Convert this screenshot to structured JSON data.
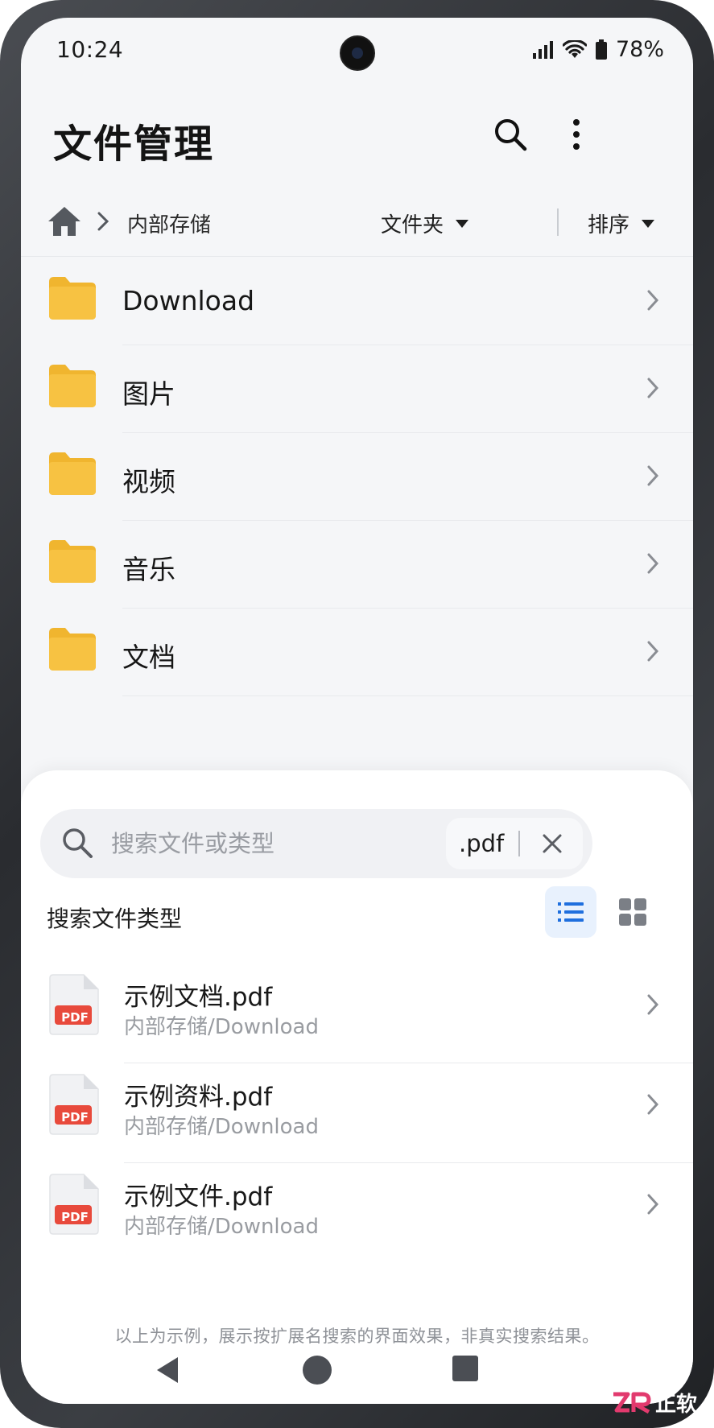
{
  "status_bar": {
    "time": "10:24",
    "battery": "78%"
  },
  "header": {
    "title": "文件管理",
    "search_icon": "search-icon",
    "more_icon": "more-vert-icon"
  },
  "breadcrumb": {
    "home_icon": "home-icon",
    "current": "内部存储",
    "filter_label": "文件夹",
    "sort_label": "排序"
  },
  "folders": [
    {
      "name": "Download"
    },
    {
      "name": "图片"
    },
    {
      "name": "视频"
    },
    {
      "name": "音乐"
    },
    {
      "name": "文档"
    }
  ],
  "search": {
    "placeholder": "搜索文件或类型",
    "value": "",
    "extension_chip": ".pdf"
  },
  "results_section": {
    "title": "搜索文件类型",
    "items": [
      {
        "name": "示例文档.pdf",
        "path": "内部存储/Download",
        "badge": "PDF"
      },
      {
        "name": "示例资料.pdf",
        "path": "内部存储/Download",
        "badge": "PDF"
      },
      {
        "name": "示例文件.pdf",
        "path": "内部存储/Download",
        "badge": "PDF"
      }
    ],
    "footnote": "以上为示例，展示按扩展名搜索的界面效果，非真实搜索结果。"
  },
  "watermark": "正软",
  "colors": {
    "folder": "#f7c242",
    "folder_tab": "#f0b52f",
    "pdf_badge": "#e84a3c",
    "accent": "#1f6fde"
  }
}
